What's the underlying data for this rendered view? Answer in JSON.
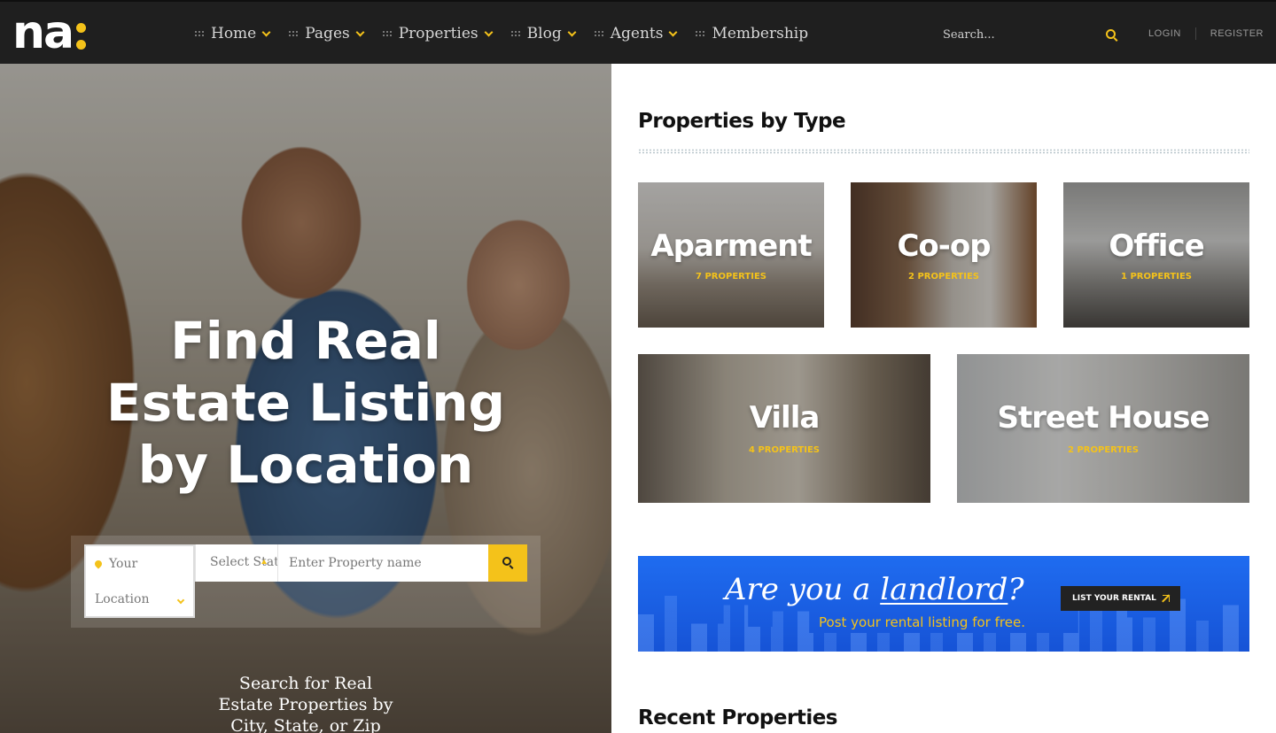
{
  "header": {
    "logo_text": "na",
    "nav": [
      {
        "label": "Home",
        "dropdown": true
      },
      {
        "label": "Pages",
        "dropdown": true
      },
      {
        "label": "Properties",
        "dropdown": true
      },
      {
        "label": "Blog",
        "dropdown": true
      },
      {
        "label": "Agents",
        "dropdown": true
      },
      {
        "label": "Membership",
        "dropdown": false
      }
    ],
    "search_placeholder": "Search...",
    "login": "LOGIN",
    "register": "REGISTER"
  },
  "hero": {
    "title": "Find Real Estate Listing by Location",
    "location_line1": "Your",
    "location_line2": "Location",
    "state_label": "Select State",
    "property_placeholder": "Enter Property name",
    "subtitle": "Search for Real Estate Properties by City, State, or Zip"
  },
  "types_section": {
    "title": "Properties by Type",
    "tiles": [
      {
        "name": "Aparment",
        "count": "7 PROPERTIES"
      },
      {
        "name": "Co-op",
        "count": "2 PROPERTIES"
      },
      {
        "name": "Office",
        "count": "1 PROPERTIES"
      },
      {
        "name": "Villa",
        "count": "4 PROPERTIES"
      },
      {
        "name": "Street House",
        "count": "2 PROPERTIES"
      }
    ]
  },
  "banner": {
    "heading_pre": "Are you a ",
    "heading_word": "landlord",
    "heading_post": "?",
    "subtext": "Post your rental listing for free.",
    "button": "LIST YOUR RENTAL"
  },
  "recent": {
    "title": "Recent Properties"
  },
  "colors": {
    "accent": "#f4c21a",
    "topbar": "#1f1f1f",
    "banner": "#1f6cf0"
  }
}
